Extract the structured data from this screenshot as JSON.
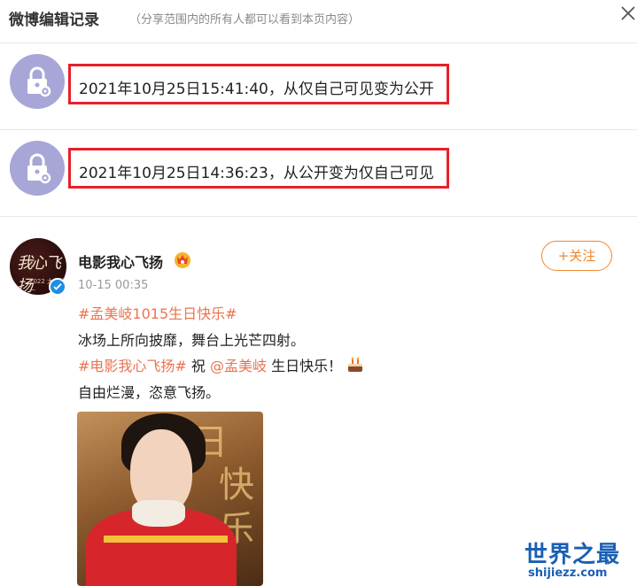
{
  "dialog": {
    "title": "微博编辑记录",
    "subtitle": "（分享范围内的所有人都可以看到本页内容）",
    "close_icon": "close-icon"
  },
  "records": [
    {
      "icon": "lock-gear-icon",
      "text": "2021年10月25日15:41:40，从仅自己可见变为公开"
    },
    {
      "icon": "lock-gear-icon",
      "text": "2021年10月25日14:36:23，从公开变为仅自己可见"
    }
  ],
  "post": {
    "author": "电影我心飞扬",
    "avatar_text": "我心飞扬",
    "avatar_sub": "2022 大年初一",
    "follow_label": "+关注",
    "time": "10-15 00:35",
    "lines": {
      "l1_tag": "#孟美岐1015生日快乐#",
      "l2": "冰场上所向披靡，舞台上光芒四射。",
      "l3_tag": "#电影我心飞扬#",
      "l3_mid": " 祝 ",
      "l3_mention": "@孟美岐",
      "l3_end": " 生日快乐！",
      "l4": "自由烂漫，恣意飞扬。"
    },
    "photo_chars": [
      "日",
      "快",
      "乐"
    ]
  },
  "watermark": {
    "title": "世界之最",
    "url": "shijiezz.com"
  },
  "colors": {
    "highlight_box": "#e8202a",
    "tag": "#eb7350",
    "follow": "#f0862f",
    "lock_avatar": "#a7a6d6",
    "watermark": "#1a5fb4"
  }
}
